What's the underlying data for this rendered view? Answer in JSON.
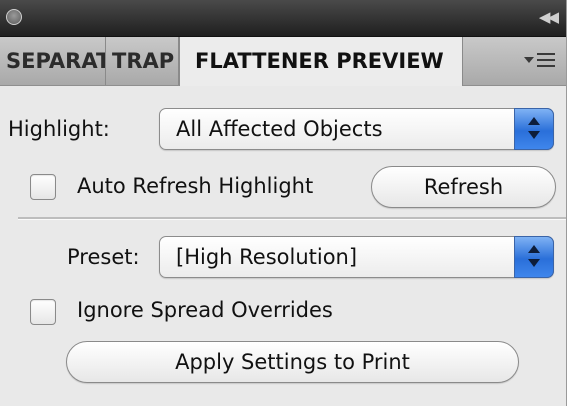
{
  "panel": {
    "tabs": [
      {
        "label": "SEPARATIONS PREVIEW",
        "active": false
      },
      {
        "label": "TRAP PRESETS",
        "active": false
      },
      {
        "label": "FLATTENER PREVIEW",
        "active": true
      }
    ],
    "title_bar": {
      "collapse_icon": "double-chevron-right-icon",
      "close_icon": "close-circle-icon"
    },
    "menu_icon": "panel-menu-icon"
  },
  "highlight": {
    "label": "Highlight:",
    "value": "All Affected Objects"
  },
  "auto_refresh": {
    "label": "Auto Refresh Highlight",
    "checked": false
  },
  "refresh_button": "Refresh",
  "preset": {
    "label": "Preset:",
    "value": "[High Resolution]"
  },
  "ignore_spread": {
    "label": "Ignore Spread Overrides",
    "checked": false
  },
  "apply_button": "Apply Settings to Print",
  "colors": {
    "panel_bg": "#e9e9e9",
    "titlebar": "#2a2a2a",
    "stepper_accent": "#2a6fd9"
  }
}
